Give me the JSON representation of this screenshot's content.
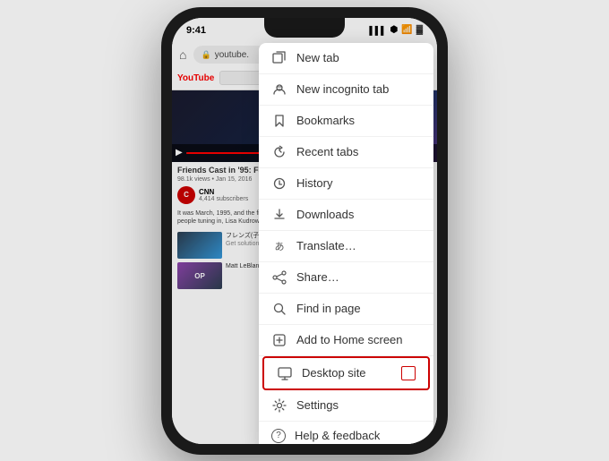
{
  "phone": {
    "status_bar": {
      "time": "9:41",
      "signal": "▌▌▌",
      "bluetooth": "B",
      "wifi": "WiFi",
      "battery": "🔋"
    },
    "browser": {
      "url": "youtube.",
      "forward_icon": "›",
      "star_icon": "☆",
      "download_icon": "⬇",
      "info_icon": "ⓘ",
      "refresh_icon": "↻"
    },
    "menu": {
      "items": [
        {
          "id": "new-tab",
          "icon": "newtab",
          "label": "New tab"
        },
        {
          "id": "new-incognito-tab",
          "icon": "incognito",
          "label": "New incognito tab"
        },
        {
          "id": "bookmarks",
          "icon": "bookmark",
          "label": "Bookmarks"
        },
        {
          "id": "recent-tabs",
          "icon": "recenttabs",
          "label": "Recent tabs"
        },
        {
          "id": "history",
          "icon": "history",
          "label": "History"
        },
        {
          "id": "downloads",
          "icon": "downloads",
          "label": "Downloads"
        },
        {
          "id": "translate",
          "icon": "translate",
          "label": "Translate…"
        },
        {
          "id": "share",
          "icon": "share",
          "label": "Share…"
        },
        {
          "id": "find-in-page",
          "icon": "find",
          "label": "Find in page"
        },
        {
          "id": "add-to-home",
          "icon": "homescreen",
          "label": "Add to Home screen"
        },
        {
          "id": "desktop-site",
          "icon": "desktop",
          "label": "Desktop site",
          "has_checkbox": true,
          "highlighted": true
        },
        {
          "id": "settings",
          "icon": "settings",
          "label": "Settings"
        },
        {
          "id": "help-feedback",
          "icon": "help",
          "label": "Help & feedback"
        }
      ]
    }
  }
}
